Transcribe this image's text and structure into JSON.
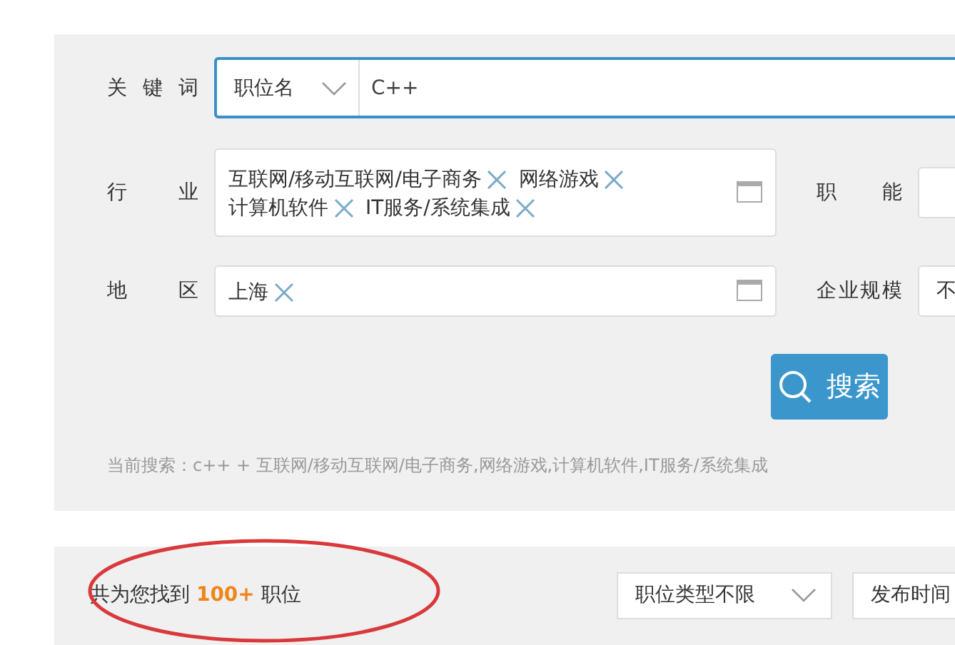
{
  "keyword": {
    "label": "关键词",
    "type": "职位名",
    "value": "C++"
  },
  "industry": {
    "label": "行业",
    "tags": [
      "互联网/移动互联网/电子商务",
      "网络游戏",
      "计算机软件",
      "IT服务/系统集成"
    ]
  },
  "function": {
    "label": "职能"
  },
  "region": {
    "label": "地区",
    "tags": [
      "上海"
    ]
  },
  "company_size": {
    "label": "企业规模",
    "value": "不"
  },
  "search_button": {
    "label": "搜索"
  },
  "current_search": "当前搜索：c++ + 互联网/移动互联网/电子商务,网络游戏,计算机软件,IT服务/系统集成",
  "results": {
    "summary": "共为您找到 **100+** 职位",
    "annotated": true
  },
  "filters": [
    {
      "value": "职位类型不限",
      "kind": "select"
    },
    {
      "value": "发布时间",
      "kind": "select"
    }
  ]
}
